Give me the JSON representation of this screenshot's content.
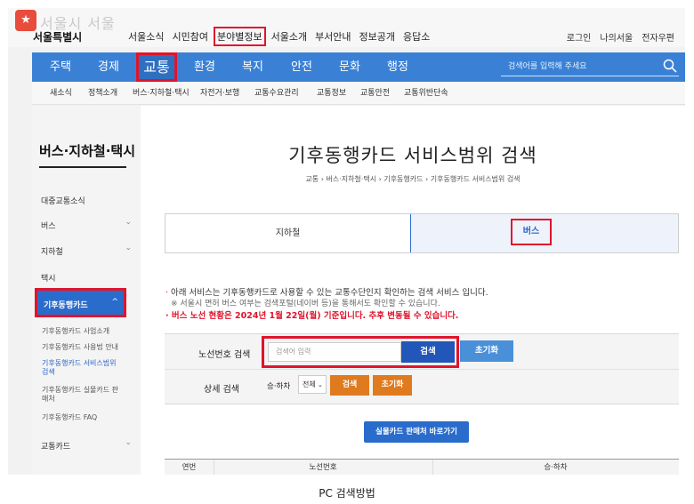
{
  "header": {
    "logo_badge": "★",
    "logo_faded": "서울시 서울",
    "logo_text": "서울특별시",
    "utility_nav": [
      "서울소식",
      "시민참여",
      "분야별정보",
      "서울소개",
      "부서안내",
      "정보공개",
      "응답소"
    ],
    "account_nav": [
      "로그인",
      "나의서울",
      "전자우편"
    ]
  },
  "main_nav": {
    "items": [
      "주택",
      "경제",
      "교통",
      "환경",
      "복지",
      "안전",
      "문화",
      "행정"
    ],
    "active": "교통",
    "search_placeholder": "검색어를 입력해 주세요"
  },
  "sub_nav": [
    "새소식",
    "정책소개",
    "버스·지하철·택시",
    "자전거·보행",
    "교통수요관리",
    "교통정보",
    "교통안전",
    "교통위반단속"
  ],
  "sidebar": {
    "title": "버스·지하철·택시",
    "items": [
      {
        "label": "대중교통소식",
        "chevron": ""
      },
      {
        "label": "버스",
        "chevron": "⌄"
      },
      {
        "label": "지하철",
        "chevron": "⌄"
      },
      {
        "label": "택시",
        "chevron": ""
      }
    ],
    "active_item": "기후동행카드",
    "active_chevron": "^",
    "sub_items": [
      "기후동행카드 사업소개",
      "기후동행카드 사용법 안내",
      "기후동행카드 서비스범위 검색",
      "기후동행카드 실물카드 판매처",
      "기후동행카드 FAQ"
    ],
    "last_item": {
      "label": "교통카드",
      "chevron": "⌄"
    }
  },
  "content": {
    "title": "기후동행카드 서비스범위 검색",
    "breadcrumb": "교통  ›  버스·지하철·택시  ›  기후동행카드  ›  기후동행카드 서비스범위 검색",
    "tabs": {
      "subway": "지하철",
      "bus": "버스"
    },
    "notes": {
      "line1": "아래 서비스는 기후동행카드로 사용할 수 있는 교통수단인지 확인하는 검색 서비스 입니다.",
      "line2": "※ 서울시 면허 버스 여부는 검색포털(네이버 등)을 통해서도 확인할 수 있습니다.",
      "line3": "버스 노선 현황은 2024년 1월 22일(월) 기준입니다. 추후 변동될 수 있습니다."
    },
    "search": {
      "route_label": "노선번호 검색",
      "route_placeholder": "검색어 입력",
      "search_button": "검색",
      "reset_button": "초기화",
      "detail_label": "상세 검색",
      "direction_label": "승·하차",
      "direction_value": "전체",
      "detail_search_button": "검색",
      "detail_reset_button": "초기화"
    },
    "store_button": "실물카드 판매처 바로가기",
    "table_headers": [
      "연번",
      "노선번호",
      "승·하차"
    ]
  },
  "caption": "PC 검색방법",
  "colors": {
    "brand_blue": "#3a81d6",
    "highlight_red": "#e0142c",
    "orange": "#e07a1e"
  }
}
